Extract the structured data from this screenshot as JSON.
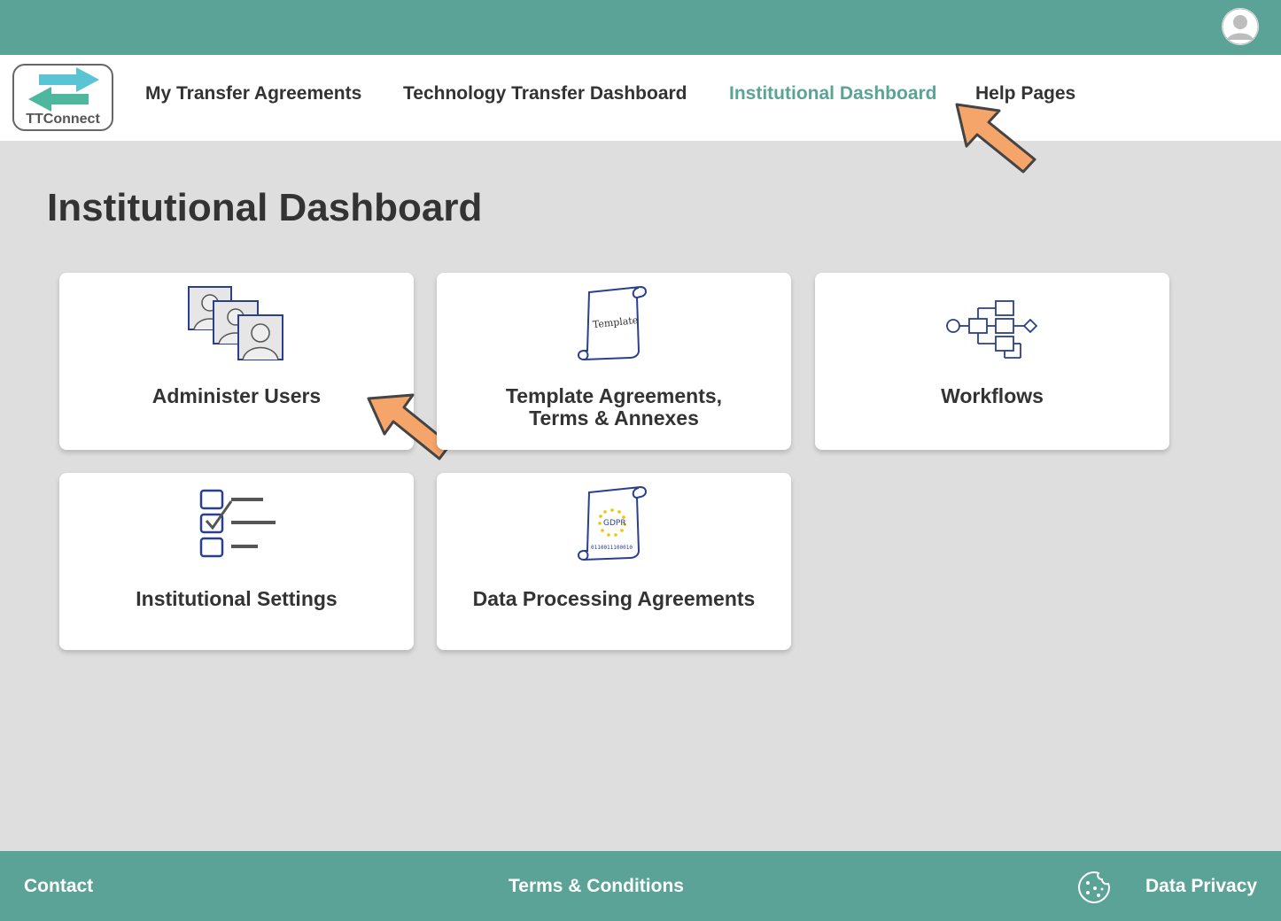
{
  "colors": {
    "brand": "#5ca397",
    "annotation_arrow": "#f6a56a",
    "background": "#dedede"
  },
  "header": {
    "profile_icon": "user-avatar-icon"
  },
  "logo": {
    "text": "TTConnect"
  },
  "nav": {
    "items": [
      {
        "label": "My Transfer Agreements"
      },
      {
        "label": "Technology Transfer Dashboard"
      },
      {
        "label": "Institutional Dashboard",
        "active": true
      },
      {
        "label": "Help Pages"
      }
    ]
  },
  "page": {
    "title": "Institutional Dashboard"
  },
  "tiles": [
    {
      "label": "Administer Users",
      "icon": "users-icon"
    },
    {
      "label": "Template Agreements,",
      "label2": "Terms & Annexes",
      "icon": "template-scroll-icon",
      "icon_text": "Template"
    },
    {
      "label": "Workflows",
      "icon": "workflow-icon"
    },
    {
      "label": "Institutional Settings",
      "icon": "checklist-icon"
    },
    {
      "label": "Data Processing Agreements",
      "icon": "gdpr-scroll-icon",
      "icon_text": "GDPR",
      "icon_subtext": "0110011100010"
    }
  ],
  "footer": {
    "contact": "Contact",
    "terms": "Terms & Conditions",
    "cookie_icon": "cookie-icon",
    "privacy": "Data Privacy"
  }
}
